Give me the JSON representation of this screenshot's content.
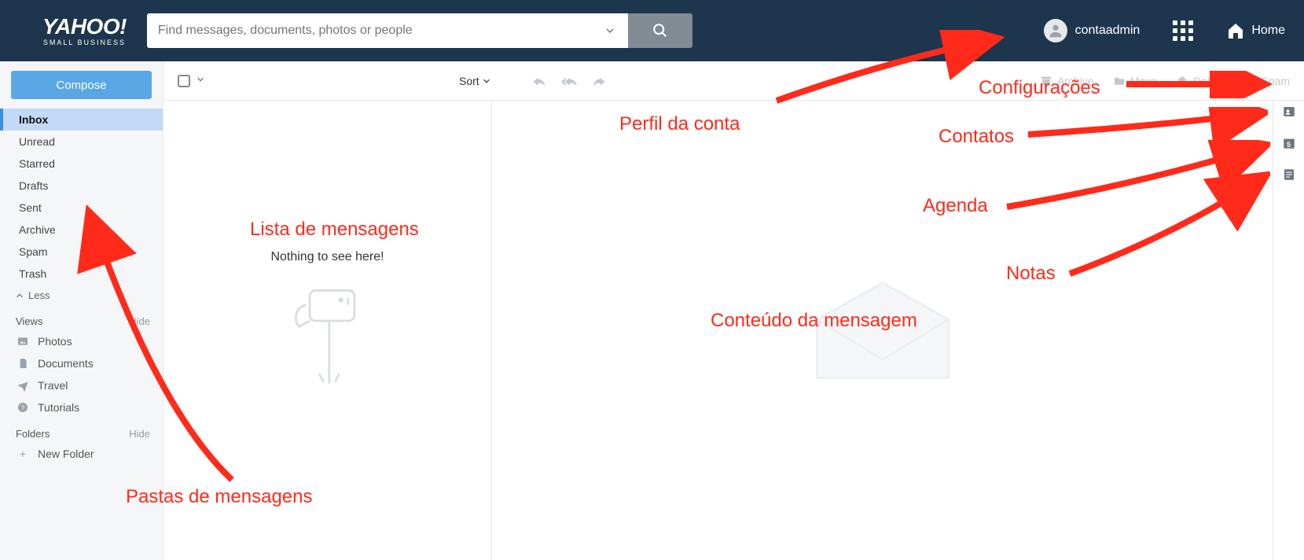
{
  "header": {
    "logo_main": "YAHOO!",
    "logo_sub": "SMALL BUSINESS",
    "search_placeholder": "Find messages, documents, photos or people",
    "profile_name": "contaadmin",
    "home_label": "Home"
  },
  "sidebar": {
    "compose_label": "Compose",
    "folders": [
      "Inbox",
      "Unread",
      "Starred",
      "Drafts",
      "Sent",
      "Archive",
      "Spam",
      "Trash"
    ],
    "less_label": "Less",
    "views_heading": "Views",
    "views_hide": "Hide",
    "views": [
      "Photos",
      "Documents",
      "Travel",
      "Tutorials"
    ],
    "folders_heading": "Folders",
    "folders_hide": "Hide",
    "new_folder": "New Folder"
  },
  "toolbar": {
    "sort_label": "Sort",
    "actions": {
      "archive": "Archive",
      "move": "Move",
      "delete": "Delete",
      "spam": "Spam"
    }
  },
  "list": {
    "empty_text": "Nothing to see here!"
  },
  "annotations": {
    "perfil": "Perfil da conta",
    "config": "Configurações",
    "contatos": "Contatos",
    "agenda": "Agenda",
    "notas": "Notas",
    "lista": "Lista de mensagens",
    "conteudo": "Conteúdo da mensagem",
    "pastas": "Pastas de mensagens"
  },
  "rail": {
    "calendar_badge": "5"
  }
}
